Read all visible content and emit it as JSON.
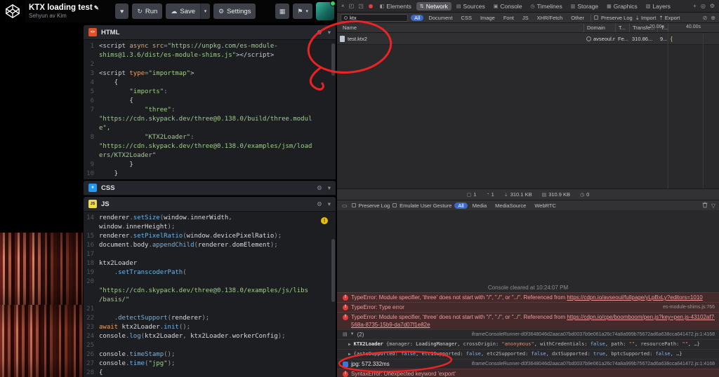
{
  "codepen": {
    "title": "KTX loading test",
    "author": "Sehyun av Kim",
    "buttons": {
      "run": "Run",
      "save": "Save",
      "settings": "Settings"
    }
  },
  "icons": {
    "heart": "♥",
    "run": "↻",
    "cloud": "☁",
    "caret": "▾",
    "gear": "⚙",
    "grid": "▦",
    "pin": "⚑",
    "pencil": "✎",
    "close": "×",
    "dock1": "◰",
    "dock2": "◳",
    "plus": "+",
    "search": "◎",
    "inspect": "⊕",
    "slash": "⊘",
    "funnel": "▽",
    "panel": "▭",
    "import": "⇣",
    "export": "⇡",
    "warning": "!"
  },
  "editors": {
    "html": {
      "label": "HTML",
      "rows": [
        {
          "n": "1",
          "s": [
            [
              "<script",
              "t"
            ],
            [
              " ",
              "p"
            ],
            [
              "async",
              "k"
            ],
            [
              " ",
              "p"
            ],
            [
              "src",
              "a"
            ],
            [
              "=",
              "d"
            ],
            [
              "\"https://unpkg.com/es-module-",
              "s"
            ]
          ]
        },
        {
          "n": "",
          "s": [
            [
              "shims@1.3.6/dist/es-module-shims.js\"",
              "s"
            ],
            [
              "></script>",
              "t"
            ]
          ]
        },
        {
          "n": "2",
          "s": []
        },
        {
          "n": "3",
          "s": [
            [
              "<script",
              "t"
            ],
            [
              " ",
              "p"
            ],
            [
              "type",
              "a"
            ],
            [
              "=",
              "d"
            ],
            [
              "\"importmap\"",
              "s"
            ],
            [
              ">",
              "t"
            ]
          ]
        },
        {
          "n": "4",
          "s": [
            [
              "    {",
              "p"
            ]
          ]
        },
        {
          "n": "5",
          "s": [
            [
              "        ",
              "p"
            ],
            [
              "\"imports\"",
              "s"
            ],
            [
              ":",
              "d"
            ]
          ]
        },
        {
          "n": "6",
          "s": [
            [
              "        {",
              "p"
            ]
          ]
        },
        {
          "n": "7",
          "s": [
            [
              "            ",
              "p"
            ],
            [
              "\"three\"",
              "s"
            ],
            [
              ":",
              "d"
            ]
          ]
        },
        {
          "n": "",
          "s": [
            [
              "\"https://cdn.skypack.dev/three@0.138.0/build/three.modul",
              "s"
            ]
          ]
        },
        {
          "n": "",
          "s": [
            [
              "e\",",
              "s"
            ]
          ]
        },
        {
          "n": "8",
          "s": [
            [
              "            ",
              "p"
            ],
            [
              "\"KTX2Loader\"",
              "s"
            ],
            [
              ":",
              "d"
            ]
          ]
        },
        {
          "n": "",
          "s": [
            [
              "\"https://cdn.skypack.dev/three@0.138.0/examples/jsm/load",
              "s"
            ]
          ]
        },
        {
          "n": "",
          "s": [
            [
              "ers/KTX2Loader\"",
              "s"
            ]
          ]
        },
        {
          "n": "9",
          "s": [
            [
              "        }",
              "p"
            ]
          ]
        },
        {
          "n": "10",
          "s": [
            [
              "    }",
              "p"
            ]
          ]
        }
      ]
    },
    "css": {
      "label": "CSS"
    },
    "js": {
      "label": "JS",
      "rows": [
        {
          "n": "14",
          "s": [
            [
              "renderer",
              "p"
            ],
            [
              ".",
              "d"
            ],
            [
              "setSize",
              "m"
            ],
            [
              "(",
              "d"
            ],
            [
              "window",
              "p"
            ],
            [
              ".",
              "d"
            ],
            [
              "innerWidth",
              "p"
            ],
            [
              ",",
              "d"
            ]
          ]
        },
        {
          "n": "",
          "s": [
            [
              "window",
              "p"
            ],
            [
              ".",
              "d"
            ],
            [
              "innerHeight",
              "p"
            ],
            [
              ");",
              "d"
            ]
          ]
        },
        {
          "n": "15",
          "s": [
            [
              "renderer",
              "p"
            ],
            [
              ".",
              "d"
            ],
            [
              "setPixelRatio",
              "m"
            ],
            [
              "(",
              "d"
            ],
            [
              "window",
              "p"
            ],
            [
              ".",
              "d"
            ],
            [
              "devicePixelRatio",
              "p"
            ],
            [
              ");",
              "d"
            ]
          ]
        },
        {
          "n": "16",
          "s": [
            [
              "document",
              "p"
            ],
            [
              ".",
              "d"
            ],
            [
              "body",
              "p"
            ],
            [
              ".",
              "d"
            ],
            [
              "appendChild",
              "m"
            ],
            [
              "(",
              "d"
            ],
            [
              "renderer",
              "p"
            ],
            [
              ".",
              "d"
            ],
            [
              "domElement",
              "p"
            ],
            [
              ");",
              "d"
            ]
          ]
        },
        {
          "n": "17",
          "s": []
        },
        {
          "n": "18",
          "s": [
            [
              "ktx2Loader",
              "p"
            ]
          ]
        },
        {
          "n": "19",
          "s": [
            [
              "    ",
              "p"
            ],
            [
              ".",
              "d"
            ],
            [
              "setTranscoderPath",
              "m"
            ],
            [
              "(",
              "d"
            ]
          ]
        },
        {
          "n": "20",
          "s": []
        },
        {
          "n": "",
          "s": [
            [
              "\"https://cdn.skypack.dev/three@0.138.0/examples/js/libs",
              "s"
            ]
          ]
        },
        {
          "n": "",
          "s": [
            [
              "/basis/\"",
              "s"
            ]
          ]
        },
        {
          "n": "21",
          "s": []
        },
        {
          "n": "22",
          "s": [
            [
              "    ",
              "p"
            ],
            [
              ".",
              "d"
            ],
            [
              "detectSupport",
              "m"
            ],
            [
              "(",
              "d"
            ],
            [
              "renderer",
              "p"
            ],
            [
              ");",
              "d"
            ]
          ]
        },
        {
          "n": "23",
          "s": [
            [
              "await",
              "k"
            ],
            [
              " ",
              "p"
            ],
            [
              "ktx2Loader",
              "p"
            ],
            [
              ".",
              "d"
            ],
            [
              "init",
              "m"
            ],
            [
              "();",
              "d"
            ]
          ]
        },
        {
          "n": "24",
          "s": [
            [
              "console",
              "p"
            ],
            [
              ".",
              "d"
            ],
            [
              "log",
              "m"
            ],
            [
              "(",
              "d"
            ],
            [
              "ktx2Loader",
              "p"
            ],
            [
              ", ",
              "d"
            ],
            [
              "ktx2Loader",
              "p"
            ],
            [
              ".",
              "d"
            ],
            [
              "workerConfig",
              "p"
            ],
            [
              ");",
              "d"
            ]
          ]
        },
        {
          "n": "25",
          "s": []
        },
        {
          "n": "26",
          "s": [
            [
              "console",
              "p"
            ],
            [
              ".",
              "d"
            ],
            [
              "timeStamp",
              "m"
            ],
            [
              "();",
              "d"
            ]
          ]
        },
        {
          "n": "27",
          "s": [
            [
              "console",
              "p"
            ],
            [
              ".",
              "d"
            ],
            [
              "time",
              "m"
            ],
            [
              "(",
              "d"
            ],
            [
              "\"jpg\"",
              "s"
            ],
            [
              ");",
              "d"
            ]
          ]
        },
        {
          "n": "28",
          "s": [
            [
              "{",
              "p"
            ]
          ]
        }
      ]
    }
  },
  "devtools": {
    "active_tab": "Network",
    "tabs": [
      {
        "label": "Elements",
        "icon": "◧"
      },
      {
        "label": "Network",
        "icon": "⇅"
      },
      {
        "label": "Sources",
        "icon": "▤"
      },
      {
        "label": "Console",
        "icon": "▣"
      },
      {
        "label": "Timelines",
        "icon": "◷"
      },
      {
        "label": "Storage",
        "icon": "▥"
      },
      {
        "label": "Graphics",
        "icon": "▦"
      },
      {
        "label": "Layers",
        "icon": "▧"
      }
    ],
    "network": {
      "filter_value": "ktx",
      "filters": [
        "All",
        "Document",
        "CSS",
        "Image",
        "Font",
        "JS",
        "XHR/Fetch",
        "Other"
      ],
      "active_filter": "All",
      "preserve_log": "Preserve Log",
      "import_label": "Import",
      "export_label": "Export",
      "columns": [
        "Name",
        "Domain",
        "T...",
        "Transfe...",
        "T..."
      ],
      "scale_labels": [
        "20.00s",
        "40.00s"
      ],
      "row": {
        "name": "test.ktx2",
        "domain": "avseoul.n...",
        "type": "Fe...",
        "transferred": "310.86...",
        "time": "9...",
        "waterfall": "{"
      },
      "summary": [
        {
          "icon": "▢",
          "value": "1"
        },
        {
          "icon": "◔",
          "value": "1"
        },
        {
          "icon": "⇣",
          "value": "310.1 KB"
        },
        {
          "icon": "▤",
          "value": "310.9 KB"
        },
        {
          "icon": "◷",
          "value": "0"
        }
      ]
    },
    "console": {
      "preserve_log": "Preserve Log",
      "emulate_user_gesture": "Emulate User Gesture",
      "filters": [
        "All",
        "Media",
        "MediaSource",
        "WebRTC"
      ],
      "active_filter": "All",
      "cleared_text": "Console cleared at 10:24:07 PM",
      "messages": [
        {
          "kind": "error",
          "text": "TypeError: Module specifier, 'three' does not start with \"/\", \"./\", or \"../\". Referenced from ",
          "link": "https://cdpn.io/avseoul/fullpage/yLpBxLy?editors=1010"
        },
        {
          "kind": "error",
          "text": "TypeError: Type error",
          "loc": "es-module-shims.js:766"
        },
        {
          "kind": "error",
          "text": "TypeError: Module specifier, 'three' does not start with \"/\", \"./\", or \"../\". Referenced from ",
          "link": "https://cdpn.io/cpe/boomboom/pen.js?key=pen.js-43102af7-",
          "link2": "568a-8735-15b9-da7d07f1e82e"
        },
        {
          "kind": "group",
          "badge": "(2)",
          "loc": "iframeConsoleRunner-d0f3648046d2aaca07bd0037b9e061a26c74a8a999b75672ad6a638cca641472.js:1:4168"
        },
        {
          "kind": "object",
          "segs": [
            [
              "KTX2Loader ",
              "cls"
            ],
            [
              "{manager: ",
              "d"
            ],
            [
              "LoadingManager",
              "v"
            ],
            [
              ", crossOrigin: ",
              "d"
            ],
            [
              "\"anonymous\"",
              "str"
            ],
            [
              ", withCredentials: ",
              "d"
            ],
            [
              "false",
              "b"
            ],
            [
              ", path: ",
              "d"
            ],
            [
              "\"\"",
              "str"
            ],
            [
              ", resourcePath: ",
              "d"
            ],
            [
              "\"\"",
              "str"
            ],
            [
              ", …}",
              "d"
            ]
          ]
        },
        {
          "kind": "object",
          "segs": [
            [
              "{astcSupported: ",
              "d"
            ],
            [
              "false",
              "b"
            ],
            [
              ", etc1Supported: ",
              "d"
            ],
            [
              "false",
              "b"
            ],
            [
              ", etc2Supported: ",
              "d"
            ],
            [
              "false",
              "b"
            ],
            [
              ", dxtSupported: ",
              "d"
            ],
            [
              "true",
              "b"
            ],
            [
              ", bptcSupported: ",
              "d"
            ],
            [
              "false",
              "b"
            ],
            [
              ", …}",
              "d"
            ]
          ]
        },
        {
          "kind": "time",
          "text": "jpg: 572.332ms",
          "loc": "iframeConsoleRunner-d0f3648046d2aaca07bd0037b9e061a26c74a8a999b75672ad6a638cca641472.js:1:4168"
        },
        {
          "kind": "error",
          "text": "SyntaxError: Unexpected keyword 'export'"
        }
      ]
    }
  }
}
